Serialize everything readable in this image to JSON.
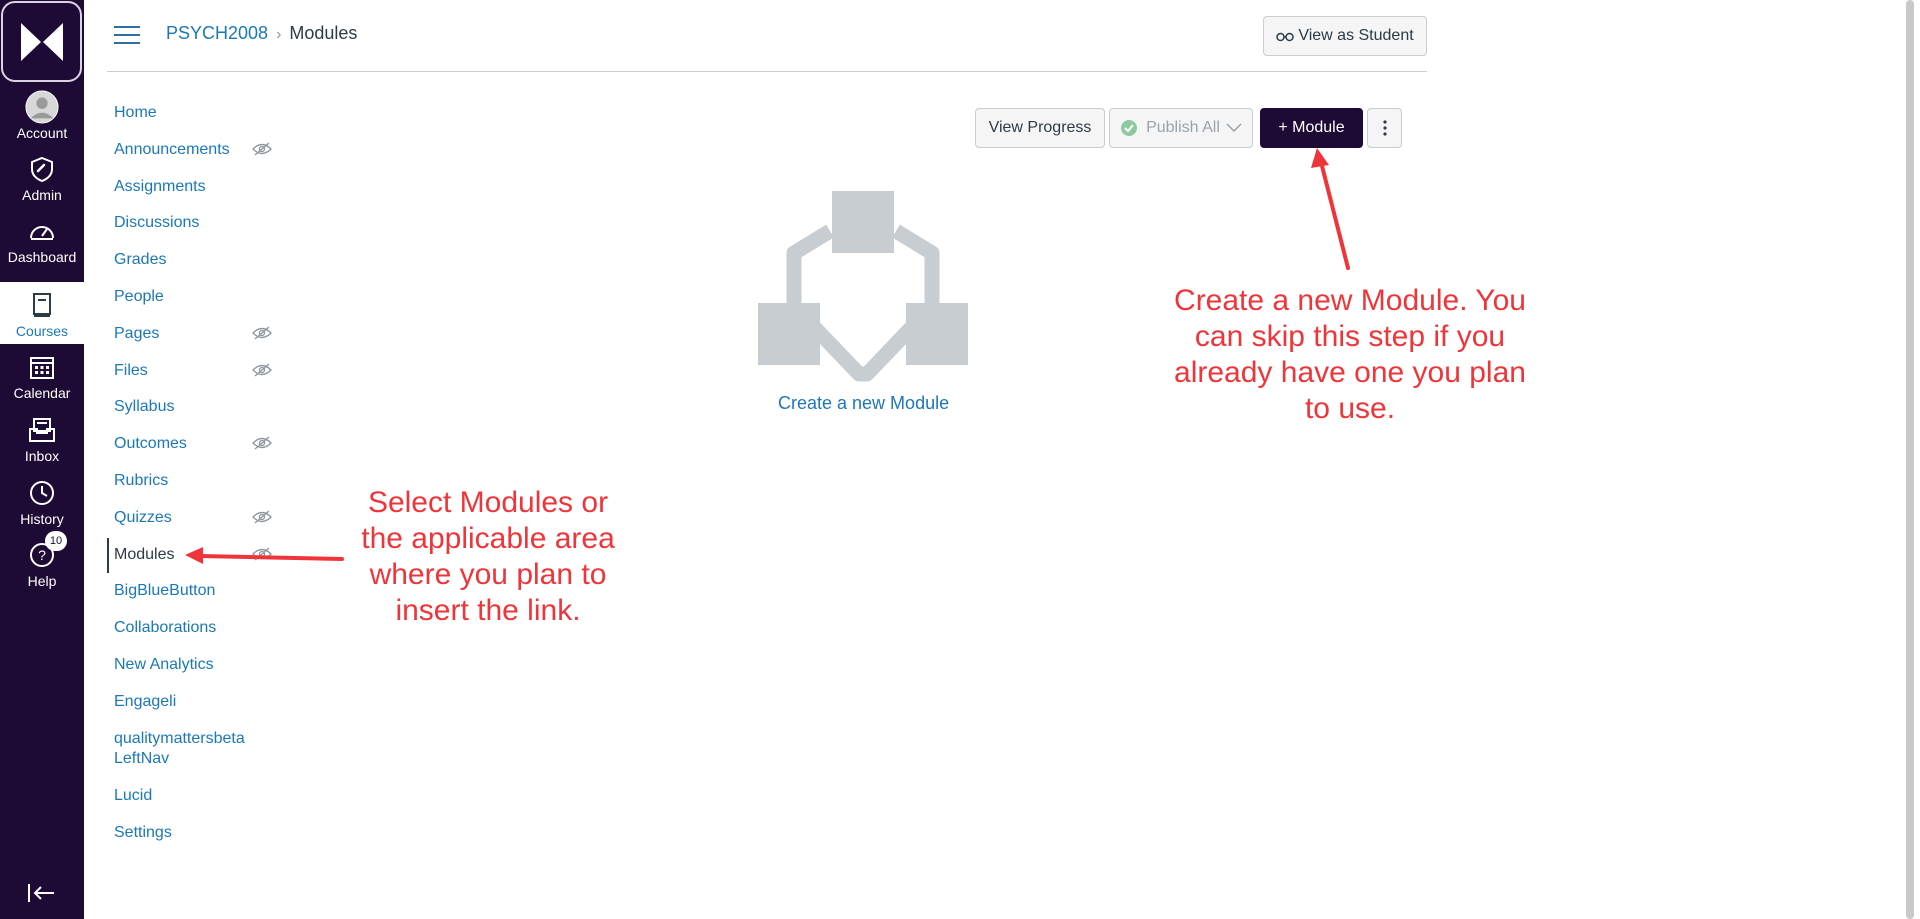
{
  "global_nav": {
    "items": [
      {
        "label": "Account",
        "icon": "account-icon"
      },
      {
        "label": "Admin",
        "icon": "admin-icon"
      },
      {
        "label": "Dashboard",
        "icon": "dashboard-icon"
      },
      {
        "label": "Courses",
        "icon": "courses-icon"
      },
      {
        "label": "Calendar",
        "icon": "calendar-icon"
      },
      {
        "label": "Inbox",
        "icon": "inbox-icon"
      },
      {
        "label": "History",
        "icon": "history-icon"
      },
      {
        "label": "Help",
        "icon": "help-icon",
        "badge": "10"
      }
    ]
  },
  "breadcrumb": {
    "course": "PSYCH2008",
    "separator": "›",
    "page": "Modules"
  },
  "header": {
    "view_as_student": "View as Student"
  },
  "toolbar": {
    "view_progress": "View Progress",
    "publish_all": "Publish All",
    "add_module": "+ Module"
  },
  "course_nav": {
    "items": [
      {
        "label": "Home",
        "hidden": false
      },
      {
        "label": "Announcements",
        "hidden": true
      },
      {
        "label": "Assignments",
        "hidden": false
      },
      {
        "label": "Discussions",
        "hidden": false
      },
      {
        "label": "Grades",
        "hidden": false
      },
      {
        "label": "People",
        "hidden": false
      },
      {
        "label": "Pages",
        "hidden": true
      },
      {
        "label": "Files",
        "hidden": true
      },
      {
        "label": "Syllabus",
        "hidden": false
      },
      {
        "label": "Outcomes",
        "hidden": true
      },
      {
        "label": "Rubrics",
        "hidden": false
      },
      {
        "label": "Quizzes",
        "hidden": true
      },
      {
        "label": "Modules",
        "hidden": true,
        "active": true
      },
      {
        "label": "BigBlueButton",
        "hidden": false
      },
      {
        "label": "Collaborations",
        "hidden": false
      },
      {
        "label": "New Analytics",
        "hidden": false
      },
      {
        "label": "Engageli",
        "hidden": false
      },
      {
        "label": "qualitymattersbeta LeftNav",
        "hidden": false
      },
      {
        "label": "Lucid",
        "hidden": false
      },
      {
        "label": "Settings",
        "hidden": false
      }
    ]
  },
  "empty_state": {
    "link": "Create a new Module"
  },
  "annotations": {
    "right": [
      "Create a new Module. You",
      "can skip this step if you",
      "already have one you plan",
      "to use."
    ],
    "left": [
      "Select Modules or",
      "the applicable area",
      "where you plan to",
      "insert the link."
    ]
  },
  "colors": {
    "nav_bg": "#1e0b35",
    "link": "#1b78b8",
    "annotation": "#f0353a",
    "primary_button": "#1e0b35"
  }
}
